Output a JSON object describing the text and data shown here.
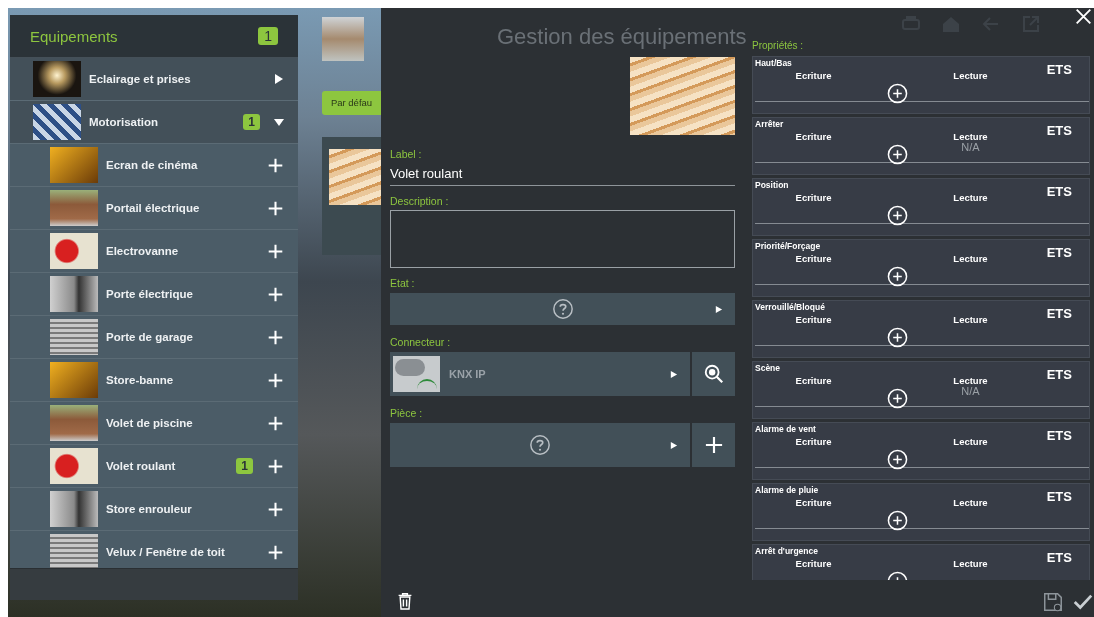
{
  "background": {
    "tabs": [
      {
        "label": "Par défau",
        "selected": true
      }
    ]
  },
  "sidebar": {
    "title": "Equipements",
    "badge": "1",
    "items": [
      {
        "label": "Eclairage et prises",
        "expanded": false
      },
      {
        "label": "Motorisation",
        "expanded": true,
        "badge": "1",
        "children": [
          {
            "label": "Ecran de cinéma"
          },
          {
            "label": "Portail électrique"
          },
          {
            "label": "Electrovanne"
          },
          {
            "label": "Porte électrique"
          },
          {
            "label": "Porte de garage"
          },
          {
            "label": "Store-banne"
          },
          {
            "label": "Volet de piscine"
          },
          {
            "label": "Volet roulant",
            "badge": "1"
          },
          {
            "label": "Store enrouleur"
          },
          {
            "label": "Velux / Fenêtre de toit"
          }
        ]
      }
    ]
  },
  "editor": {
    "title": "Gestion des équipements",
    "label": {
      "caption": "Label :",
      "value": "Volet roulant"
    },
    "description": {
      "caption": "Description :"
    },
    "state": {
      "caption": "Etat :"
    },
    "connector": {
      "caption": "Connecteur :",
      "value": "KNX IP"
    },
    "room": {
      "caption": "Pièce :"
    }
  },
  "properties": {
    "title": "Propriétés :",
    "items": [
      {
        "name": "Haut/Bas",
        "write": "Ecriture",
        "read": "Lecture",
        "ets": "ETS"
      },
      {
        "name": "Arrêter",
        "write": "Ecriture",
        "read": "Lecture",
        "ets": "ETS",
        "read_value": "N/A"
      },
      {
        "name": "Position",
        "write": "Ecriture",
        "read": "Lecture",
        "ets": "ETS"
      },
      {
        "name": "Priorité/Forçage",
        "write": "Ecriture",
        "read": "Lecture",
        "ets": "ETS"
      },
      {
        "name": "Verrouillé/Bloqué",
        "write": "Ecriture",
        "read": "Lecture",
        "ets": "ETS"
      },
      {
        "name": "Scène",
        "write": "Ecriture",
        "read": "Lecture",
        "ets": "ETS",
        "read_value": "N/A"
      },
      {
        "name": "Alarme de vent",
        "write": "Ecriture",
        "read": "Lecture",
        "ets": "ETS"
      },
      {
        "name": "Alarme de pluie",
        "write": "Ecriture",
        "read": "Lecture",
        "ets": "ETS"
      },
      {
        "name": "Arrêt d'urgence",
        "write": "Ecriture",
        "read": "Lecture",
        "ets": "ETS"
      }
    ]
  }
}
